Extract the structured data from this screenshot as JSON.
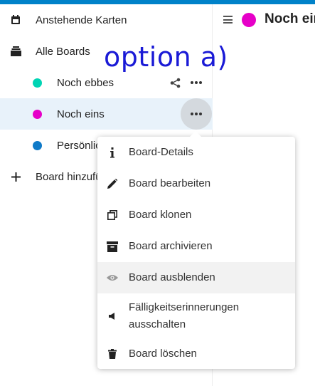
{
  "overlay_annotation": "option a)",
  "sidebar": {
    "items": [
      {
        "label": "Anstehende Karten",
        "icon": "calendar-icon"
      },
      {
        "label": "Alle Boards",
        "icon": "archive-stack-icon"
      },
      {
        "label": "Noch ebbes",
        "color": "#00d4b4"
      },
      {
        "label": "Noch eins",
        "color": "#e600c8",
        "active": true
      },
      {
        "label": "Persönlic",
        "color": "#0f7ac8"
      },
      {
        "label": "Board hinzufü",
        "icon": "plus-icon"
      }
    ]
  },
  "main": {
    "title": "Noch eins",
    "title_color": "#e600c8"
  },
  "menu": {
    "items": [
      {
        "label": "Board-Details",
        "icon": "info-icon"
      },
      {
        "label": "Board bearbeiten",
        "icon": "pencil-icon"
      },
      {
        "label": "Board klonen",
        "icon": "clone-icon"
      },
      {
        "label": "Board archivieren",
        "icon": "archive-icon"
      },
      {
        "label": "Board ausblenden",
        "icon": "eye-icon",
        "hover": true
      },
      {
        "label": "Fälligkeitserinnerungen ausschalten",
        "icon": "mute-icon"
      },
      {
        "label": "Board löschen",
        "icon": "trash-icon"
      }
    ]
  },
  "colors": {
    "accent": "#0082c9",
    "active_row": "#e8f2fa",
    "annotation": "#1a1ad6"
  }
}
